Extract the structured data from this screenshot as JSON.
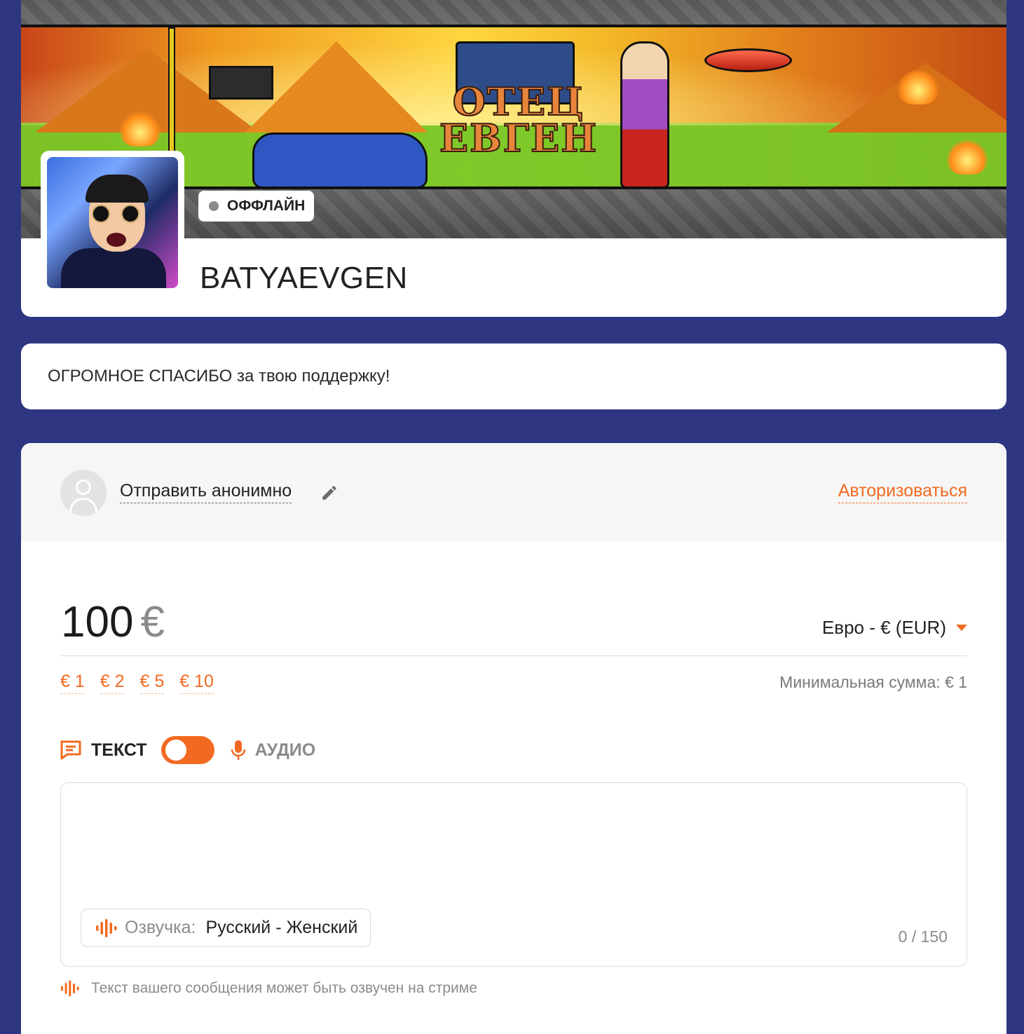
{
  "colors": {
    "page_background": "#2f3681",
    "accent": "#f26a21",
    "muted_text": "#8b8b8b"
  },
  "header": {
    "status": "ОФФЛАЙН",
    "streamer_name": "BATYAEVGEN",
    "banner_logo_text": "ОТЕЦ ЕВГЕН"
  },
  "thanks": {
    "message": "ОГРОМНОЕ СПАСИБО за твою поддержку!"
  },
  "donate": {
    "anon_label": "Отправить анонимно",
    "auth_link": "Авторизоваться",
    "amount_value": "100",
    "amount_currency_symbol": "€",
    "currency_select": "Евро - € (EUR)",
    "quick_amounts": [
      "€ 1",
      "€ 2",
      "€ 5",
      "€ 10"
    ],
    "min_sum": "Минимальная сумма: € 1",
    "mode_text": "ТЕКСТ",
    "mode_audio": "АУДИО",
    "voice_label": "Озвучка:",
    "voice_value": "Русский - Женский",
    "char_count": "0 / 150",
    "tts_note": "Текст вашего сообщения может быть озвучен на стриме"
  },
  "icons": [
    "pencil-icon",
    "user-placeholder-icon",
    "chat-icon",
    "mic-icon",
    "soundwave-icon",
    "chevron-down-icon"
  ]
}
